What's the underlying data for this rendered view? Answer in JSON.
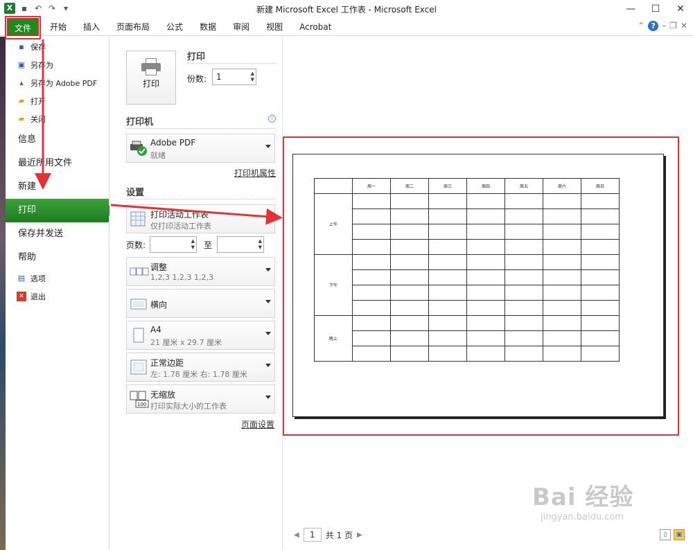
{
  "window": {
    "title": "新建 Microsoft Excel 工作表 - Microsoft Excel",
    "minimize": "—",
    "maximize": "☐",
    "close": "✕"
  },
  "qat": {
    "logo": "X",
    "save_icon": "save-icon",
    "undo_icon": "undo-icon",
    "redo_icon": "redo-icon"
  },
  "ribbon": {
    "file_tab": "文件",
    "tabs": [
      "开始",
      "插入",
      "页面布局",
      "公式",
      "数据",
      "审阅",
      "视图",
      "Acrobat"
    ],
    "help": "?"
  },
  "nav": {
    "small_top": [
      {
        "label": "保存",
        "icon": "save-icon"
      },
      {
        "label": "另存为",
        "icon": "save-as-icon"
      },
      {
        "label": "另存为 Adobe PDF",
        "icon": "pdf-icon"
      },
      {
        "label": "打开",
        "icon": "open-folder-icon"
      },
      {
        "label": "关闭",
        "icon": "close-folder-icon"
      }
    ],
    "big": [
      "信息",
      "最近所用文件",
      "新建",
      "打印",
      "保存并发送",
      "帮助"
    ],
    "active": "打印",
    "small_bottom": [
      {
        "label": "选项",
        "icon": "options-icon"
      },
      {
        "label": "退出",
        "icon": "exit-icon"
      }
    ]
  },
  "print": {
    "button_label": "打印",
    "section_title": "打印",
    "copies_label": "份数:",
    "copies_value": "1",
    "printer_title": "打印机",
    "printer_name": "Adobe PDF",
    "printer_status": "就绪",
    "printer_props_link": "打印机属性",
    "settings_title": "设置",
    "scope_title": "打印活动工作表",
    "scope_sub": "仅打印活动工作表",
    "pages_label": "页数:",
    "to_label": "至",
    "collate_title": "调整",
    "collate_sub": "1,2,3    1,2,3    1,2,3",
    "orientation": "横向",
    "paper_title": "A4",
    "paper_sub": "21 厘米 x 29.7 厘米",
    "margins_title": "正常边距",
    "margins_sub": "左: 1.78 厘米    右: 1.78 厘米",
    "scaling_title": "无缩放",
    "scaling_sub": "打印实际大小的工作表",
    "page_setup_link": "页面设置"
  },
  "preview": {
    "days": [
      "周一",
      "周二",
      "周三",
      "周四",
      "周五",
      "周六",
      "周日"
    ],
    "periods": [
      "上午",
      "下午",
      "晚上"
    ],
    "page_current": "1",
    "page_total": "共 1 页"
  },
  "watermark": {
    "brand": "Bai 经验",
    "url": "jingyan.baidu.com"
  }
}
